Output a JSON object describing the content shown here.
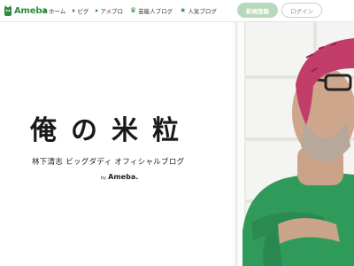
{
  "header": {
    "logo_text": "Ameba",
    "nav": [
      {
        "label": "ホーム",
        "icon": "triangle-icon"
      },
      {
        "label": "ピグ",
        "icon": "triangle-icon"
      },
      {
        "label": "アメブロ",
        "icon": "triangle-icon"
      },
      {
        "label": "芸能人ブログ",
        "icon": "crown-icon"
      },
      {
        "label": "人気ブログ",
        "icon": "star-icon"
      }
    ],
    "signup_label": "新規登録",
    "login_label": "ログイン"
  },
  "hero": {
    "title": "俺の米粒",
    "subtitle": "林下清志 ビッグダディ オフィシャルブログ",
    "by_text": "by",
    "brand_text": "Ameba."
  },
  "colors": {
    "brand_green": "#2d8c3c",
    "signup_bg": "#b7d9bb",
    "shirt_green": "#2f9a5a",
    "bandana_pink": "#c23d6a"
  }
}
